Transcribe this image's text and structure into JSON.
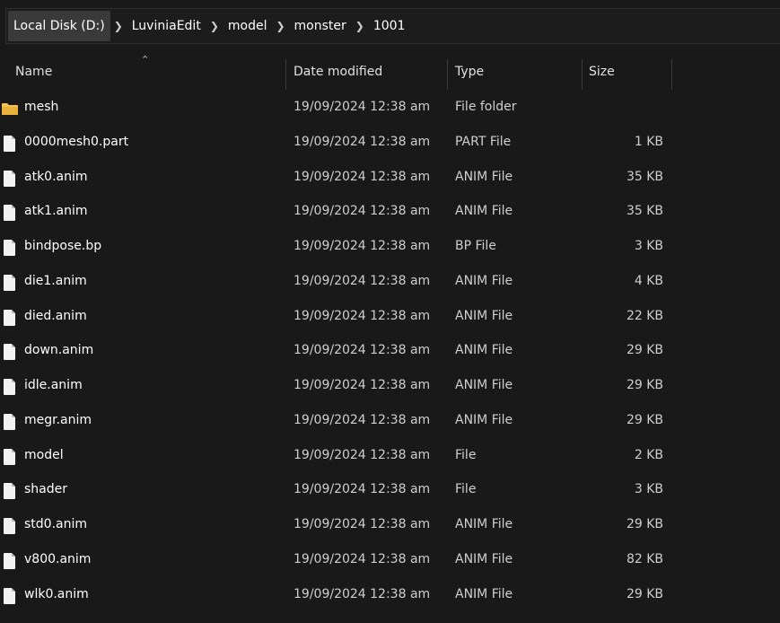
{
  "breadcrumb": [
    "Local Disk (D:)",
    "LuviniaEdit",
    "model",
    "monster",
    "1001"
  ],
  "columns": {
    "name": "Name",
    "date": "Date modified",
    "type": "Type",
    "size": "Size"
  },
  "files": [
    {
      "name": "mesh",
      "date": "19/09/2024 12:38 am",
      "type": "File folder",
      "size": "",
      "icon": "folder-icon"
    },
    {
      "name": "0000mesh0.part",
      "date": "19/09/2024 12:38 am",
      "type": "PART File",
      "size": "1 KB",
      "icon": "file-icon"
    },
    {
      "name": "atk0.anim",
      "date": "19/09/2024 12:38 am",
      "type": "ANIM File",
      "size": "35 KB",
      "icon": "file-icon"
    },
    {
      "name": "atk1.anim",
      "date": "19/09/2024 12:38 am",
      "type": "ANIM File",
      "size": "35 KB",
      "icon": "file-icon"
    },
    {
      "name": "bindpose.bp",
      "date": "19/09/2024 12:38 am",
      "type": "BP File",
      "size": "3 KB",
      "icon": "file-icon"
    },
    {
      "name": "die1.anim",
      "date": "19/09/2024 12:38 am",
      "type": "ANIM File",
      "size": "4 KB",
      "icon": "file-icon"
    },
    {
      "name": "died.anim",
      "date": "19/09/2024 12:38 am",
      "type": "ANIM File",
      "size": "22 KB",
      "icon": "file-icon"
    },
    {
      "name": "down.anim",
      "date": "19/09/2024 12:38 am",
      "type": "ANIM File",
      "size": "29 KB",
      "icon": "file-icon"
    },
    {
      "name": "idle.anim",
      "date": "19/09/2024 12:38 am",
      "type": "ANIM File",
      "size": "29 KB",
      "icon": "file-icon"
    },
    {
      "name": "megr.anim",
      "date": "19/09/2024 12:38 am",
      "type": "ANIM File",
      "size": "29 KB",
      "icon": "file-icon"
    },
    {
      "name": "model",
      "date": "19/09/2024 12:38 am",
      "type": "File",
      "size": "2 KB",
      "icon": "file-icon"
    },
    {
      "name": "shader",
      "date": "19/09/2024 12:38 am",
      "type": "File",
      "size": "3 KB",
      "icon": "file-icon"
    },
    {
      "name": "std0.anim",
      "date": "19/09/2024 12:38 am",
      "type": "ANIM File",
      "size": "29 KB",
      "icon": "file-icon"
    },
    {
      "name": "v800.anim",
      "date": "19/09/2024 12:38 am",
      "type": "ANIM File",
      "size": "82 KB",
      "icon": "file-icon"
    },
    {
      "name": "wlk0.anim",
      "date": "19/09/2024 12:38 am",
      "type": "ANIM File",
      "size": "29 KB",
      "icon": "file-icon"
    }
  ],
  "colors": {
    "background": "#191919",
    "folder": "#f4c350",
    "file": "#f2f2f2"
  }
}
